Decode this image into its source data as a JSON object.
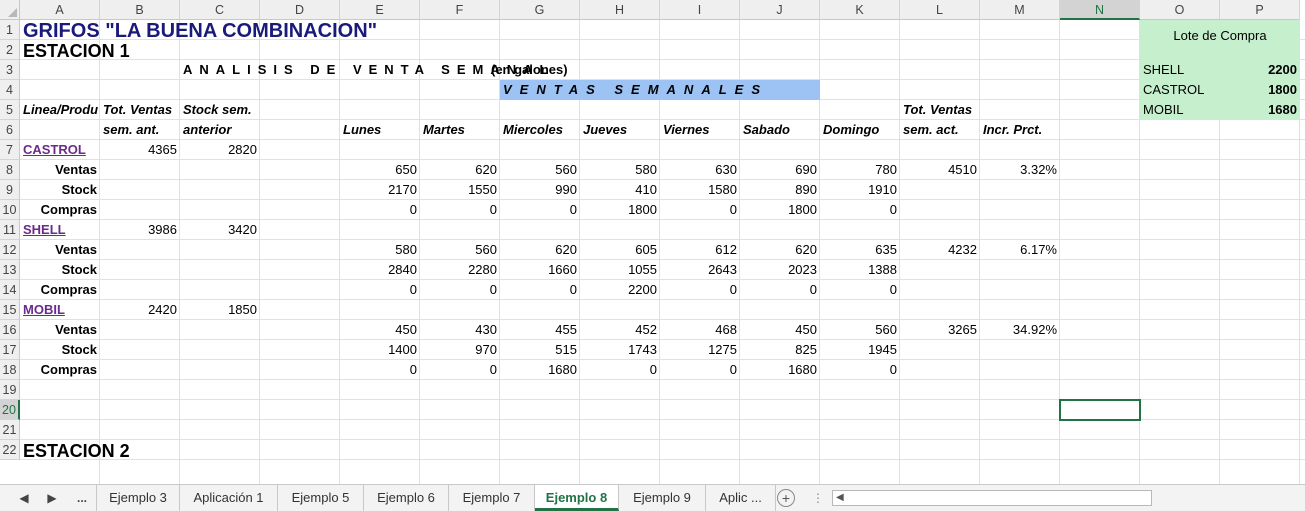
{
  "columns": [
    "A",
    "B",
    "C",
    "D",
    "E",
    "F",
    "G",
    "H",
    "I",
    "J",
    "K",
    "L",
    "M",
    "N",
    "O",
    "P"
  ],
  "active_column": "N",
  "rows": [
    "1",
    "2",
    "3",
    "4",
    "5",
    "6",
    "7",
    "8",
    "9",
    "10",
    "11",
    "12",
    "13",
    "14",
    "15",
    "16",
    "17",
    "18",
    "19",
    "20",
    "21",
    "22"
  ],
  "active_row": "20",
  "sheet": {
    "title": "GRIFOS \"LA BUENA COMBINACION\"",
    "station1": "ESTACION 1",
    "station2": "ESTACION 2",
    "analysis_title": "ANALISIS DE VENTA SEMANAL",
    "analysis_unit": "(en galones)",
    "weekly_band": "VENTAS SEMANALES",
    "headers": {
      "line_product": "Linea/Produ",
      "tot_prev_1": "Tot. Ventas",
      "tot_prev_2": "sem. ant.",
      "stock_prev_1": "Stock sem.",
      "stock_prev_2": "anterior",
      "days": [
        "Lunes",
        "Martes",
        "Miercoles",
        "Jueves",
        "Viernes",
        "Sabado",
        "Domingo"
      ],
      "tot_act_1": "Tot. Ventas",
      "tot_act_2": "sem. act.",
      "incr": "Incr. Prct."
    },
    "sub_labels": {
      "sales": "Ventas",
      "stock": "Stock",
      "purchases": "Compras"
    },
    "products": [
      {
        "name": "CASTROL",
        "prev_total": "4365",
        "prev_stock": "2820",
        "sales": [
          "650",
          "620",
          "560",
          "580",
          "630",
          "690",
          "780"
        ],
        "sales_total": "4510",
        "incr": "3.32%",
        "stock": [
          "2170",
          "1550",
          "990",
          "410",
          "1580",
          "890",
          "1910"
        ],
        "purchases": [
          "0",
          "0",
          "0",
          "1800",
          "0",
          "1800",
          "0"
        ]
      },
      {
        "name": "SHELL",
        "prev_total": "3986",
        "prev_stock": "3420",
        "sales": [
          "580",
          "560",
          "620",
          "605",
          "612",
          "620",
          "635"
        ],
        "sales_total": "4232",
        "incr": "6.17%",
        "stock": [
          "2840",
          "2280",
          "1660",
          "1055",
          "2643",
          "2023",
          "1388"
        ],
        "purchases": [
          "0",
          "0",
          "0",
          "2200",
          "0",
          "0",
          "0"
        ]
      },
      {
        "name": "MOBIL",
        "prev_total": "2420",
        "prev_stock": "1850",
        "sales": [
          "450",
          "430",
          "455",
          "452",
          "468",
          "450",
          "560"
        ],
        "sales_total": "3265",
        "incr": "34.92%",
        "stock": [
          "1400",
          "970",
          "515",
          "1743",
          "1275",
          "825",
          "1945"
        ],
        "purchases": [
          "0",
          "0",
          "1680",
          "0",
          "0",
          "1680",
          "0"
        ]
      }
    ],
    "lot": {
      "title": "Lote de Compra",
      "items": [
        {
          "name": "SHELL",
          "value": "2200"
        },
        {
          "name": "CASTROL",
          "value": "1800"
        },
        {
          "name": "MOBIL",
          "value": "1680"
        }
      ]
    }
  },
  "tabs": {
    "nav_prev": "◀",
    "nav_next": "▶",
    "ellipsis": "...",
    "items": [
      "Ejemplo 3",
      "Aplicación 1",
      "Ejemplo 5",
      "Ejemplo 6",
      "Ejemplo 7",
      "Ejemplo 8",
      "Ejemplo 9",
      "Aplic ..."
    ],
    "active": "Ejemplo 8",
    "add": "+"
  },
  "colors": {
    "accent": "#217346",
    "band": "#9dc3f5",
    "lot_box": "#c6efce",
    "title": "#1a1a7a",
    "link": "#6b2a8c"
  }
}
